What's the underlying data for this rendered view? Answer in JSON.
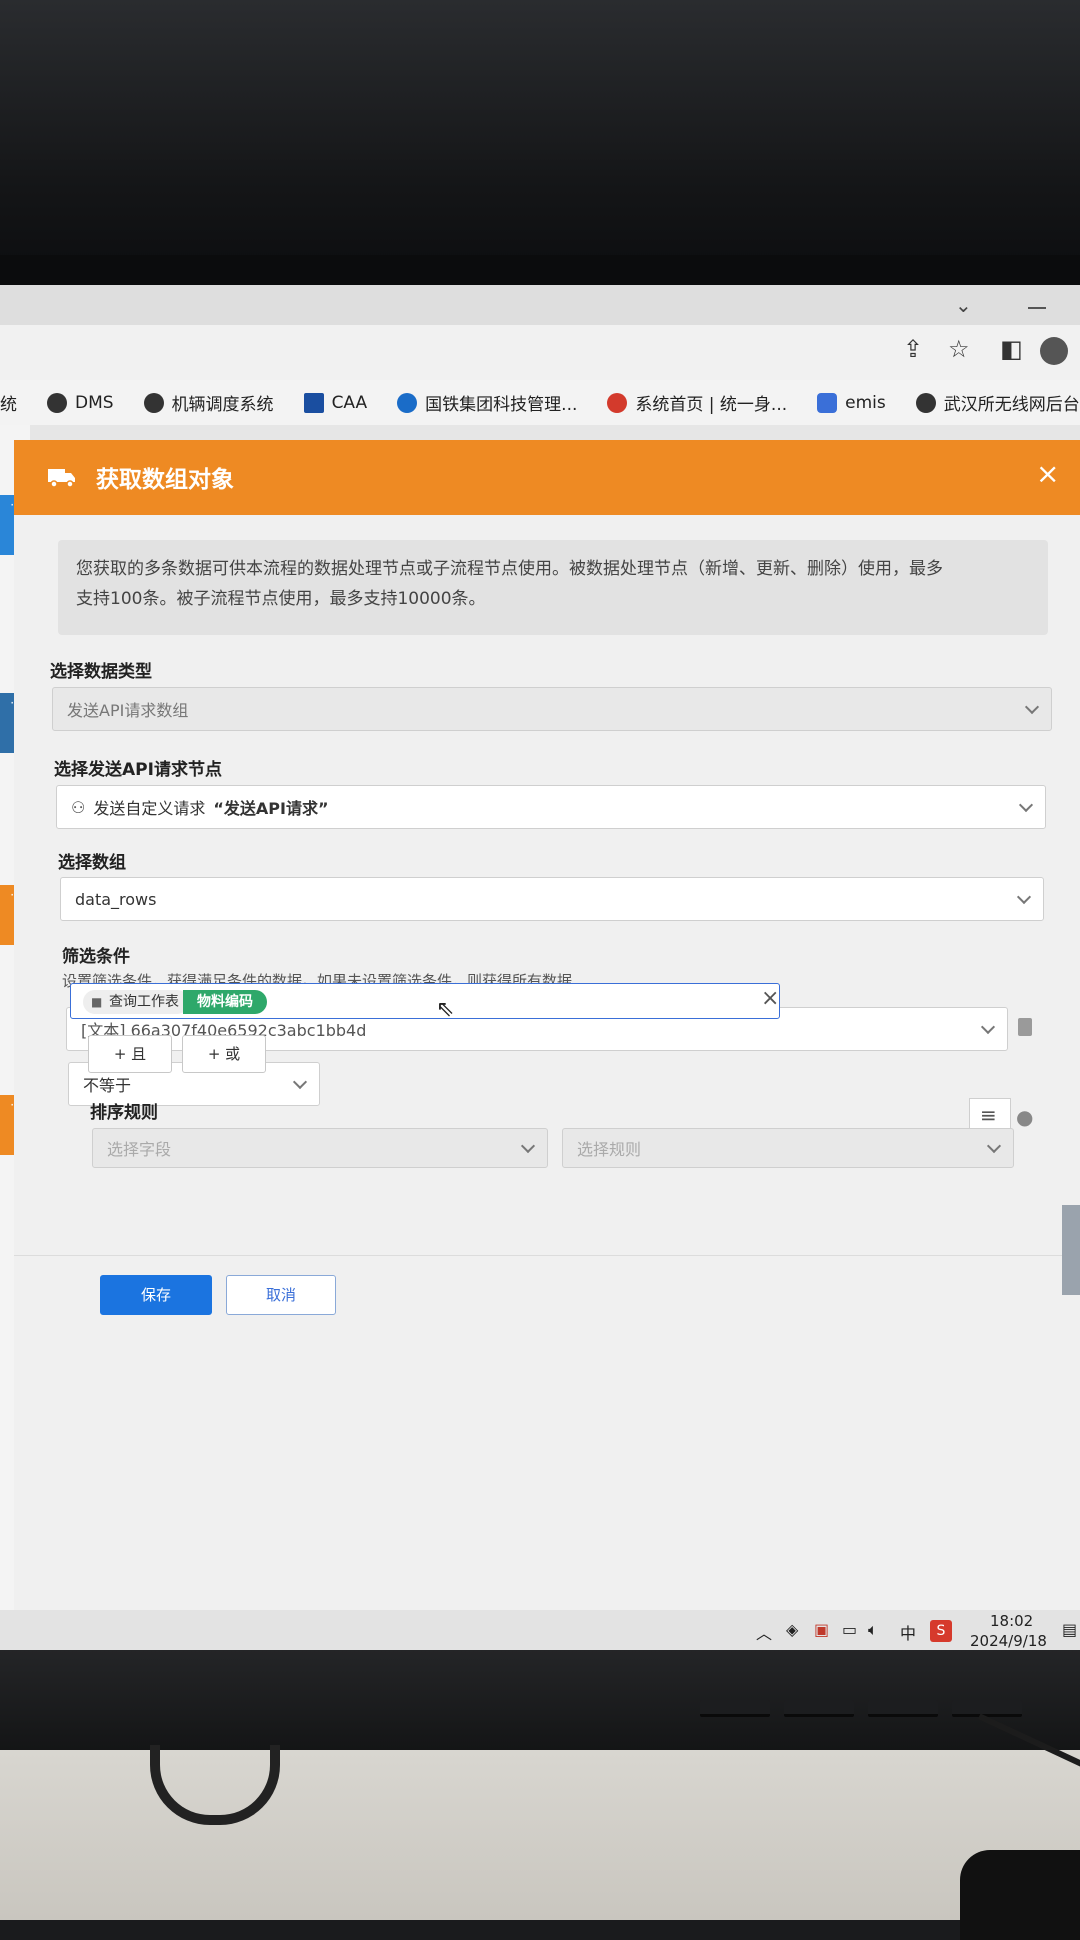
{
  "bookmarks": [
    {
      "label": "统",
      "color": "#888888"
    },
    {
      "label": "DMS",
      "color": "#333333"
    },
    {
      "label": "机辆调度系统",
      "color": "#333333"
    },
    {
      "label": "CAA",
      "color": "#1a4ea0"
    },
    {
      "label": "国铁集团科技管理...",
      "color": "#1a6cc8"
    },
    {
      "label": "系统首页 | 统一身...",
      "color": "#d33a2c"
    },
    {
      "label": "emis",
      "color": "#3a6fd8"
    },
    {
      "label": "武汉所无线网后台",
      "color": "#333333"
    }
  ],
  "dialog": {
    "title": "获取数组对象",
    "close": "×",
    "notice_line1": "您获取的多条数据可供本流程的数据处理节点或子流程节点使用。被数据处理节点（新增、更新、删除）使用，最多",
    "notice_line2": "支持100条。被子流程节点使用，最多支持10000条。",
    "data_type_label": "选择数据类型",
    "data_type_value": "发送API请求数组",
    "api_node_label": "选择发送API请求节点",
    "api_node_value": "发送自定义请求",
    "api_node_name": "“发送API请求”",
    "array_label": "选择数组",
    "array_value": "data_rows",
    "filter_label": "筛选条件",
    "filter_desc": "设置筛选条件，获得满足条件的数据。如果未设置筛选条件，则获得所有数据",
    "filter_field": "[文本] 66a307f40e6592c3abc1bb4d",
    "filter_op": "不等于",
    "token_source": "查询工作表",
    "token_field": "物料编码",
    "btn_and": "+ 且",
    "btn_or": "+ 或",
    "sort_label": "排序规则",
    "sort_field_placeholder": "选择字段",
    "sort_rule_placeholder": "选择规则",
    "save": "保存",
    "cancel": "取消",
    "accent_color": "#ee8a23",
    "primary_color": "#1b74e0"
  },
  "taskbar": {
    "ime": "中",
    "time": "18:02",
    "date": "2024/9/18"
  }
}
